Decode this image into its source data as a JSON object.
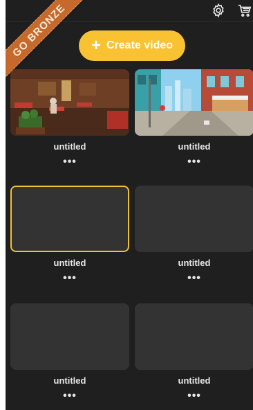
{
  "header": {
    "settings_icon": "settings-gear-icon",
    "cart_icon": "shopping-cart-icon"
  },
  "promo_ribbon": {
    "label": "GO BRONZE",
    "color": "#c56a2c"
  },
  "create_button": {
    "label": "Create video",
    "icon": "plus-icon",
    "color": "#f9c233"
  },
  "videos": [
    {
      "title": "untitled",
      "thumbnail": "restaurant-scene",
      "more_label": "•••",
      "selected": false
    },
    {
      "title": "untitled",
      "thumbnail": "city-street-scene",
      "more_label": "•••",
      "selected": false
    },
    {
      "title": "untitled",
      "thumbnail": "empty",
      "more_label": "•••",
      "selected": true
    },
    {
      "title": "untitled",
      "thumbnail": "empty",
      "more_label": "•••",
      "selected": false
    },
    {
      "title": "untitled",
      "thumbnail": "empty",
      "more_label": "•••",
      "selected": false
    },
    {
      "title": "untitled",
      "thumbnail": "empty",
      "more_label": "•••",
      "selected": false
    }
  ]
}
